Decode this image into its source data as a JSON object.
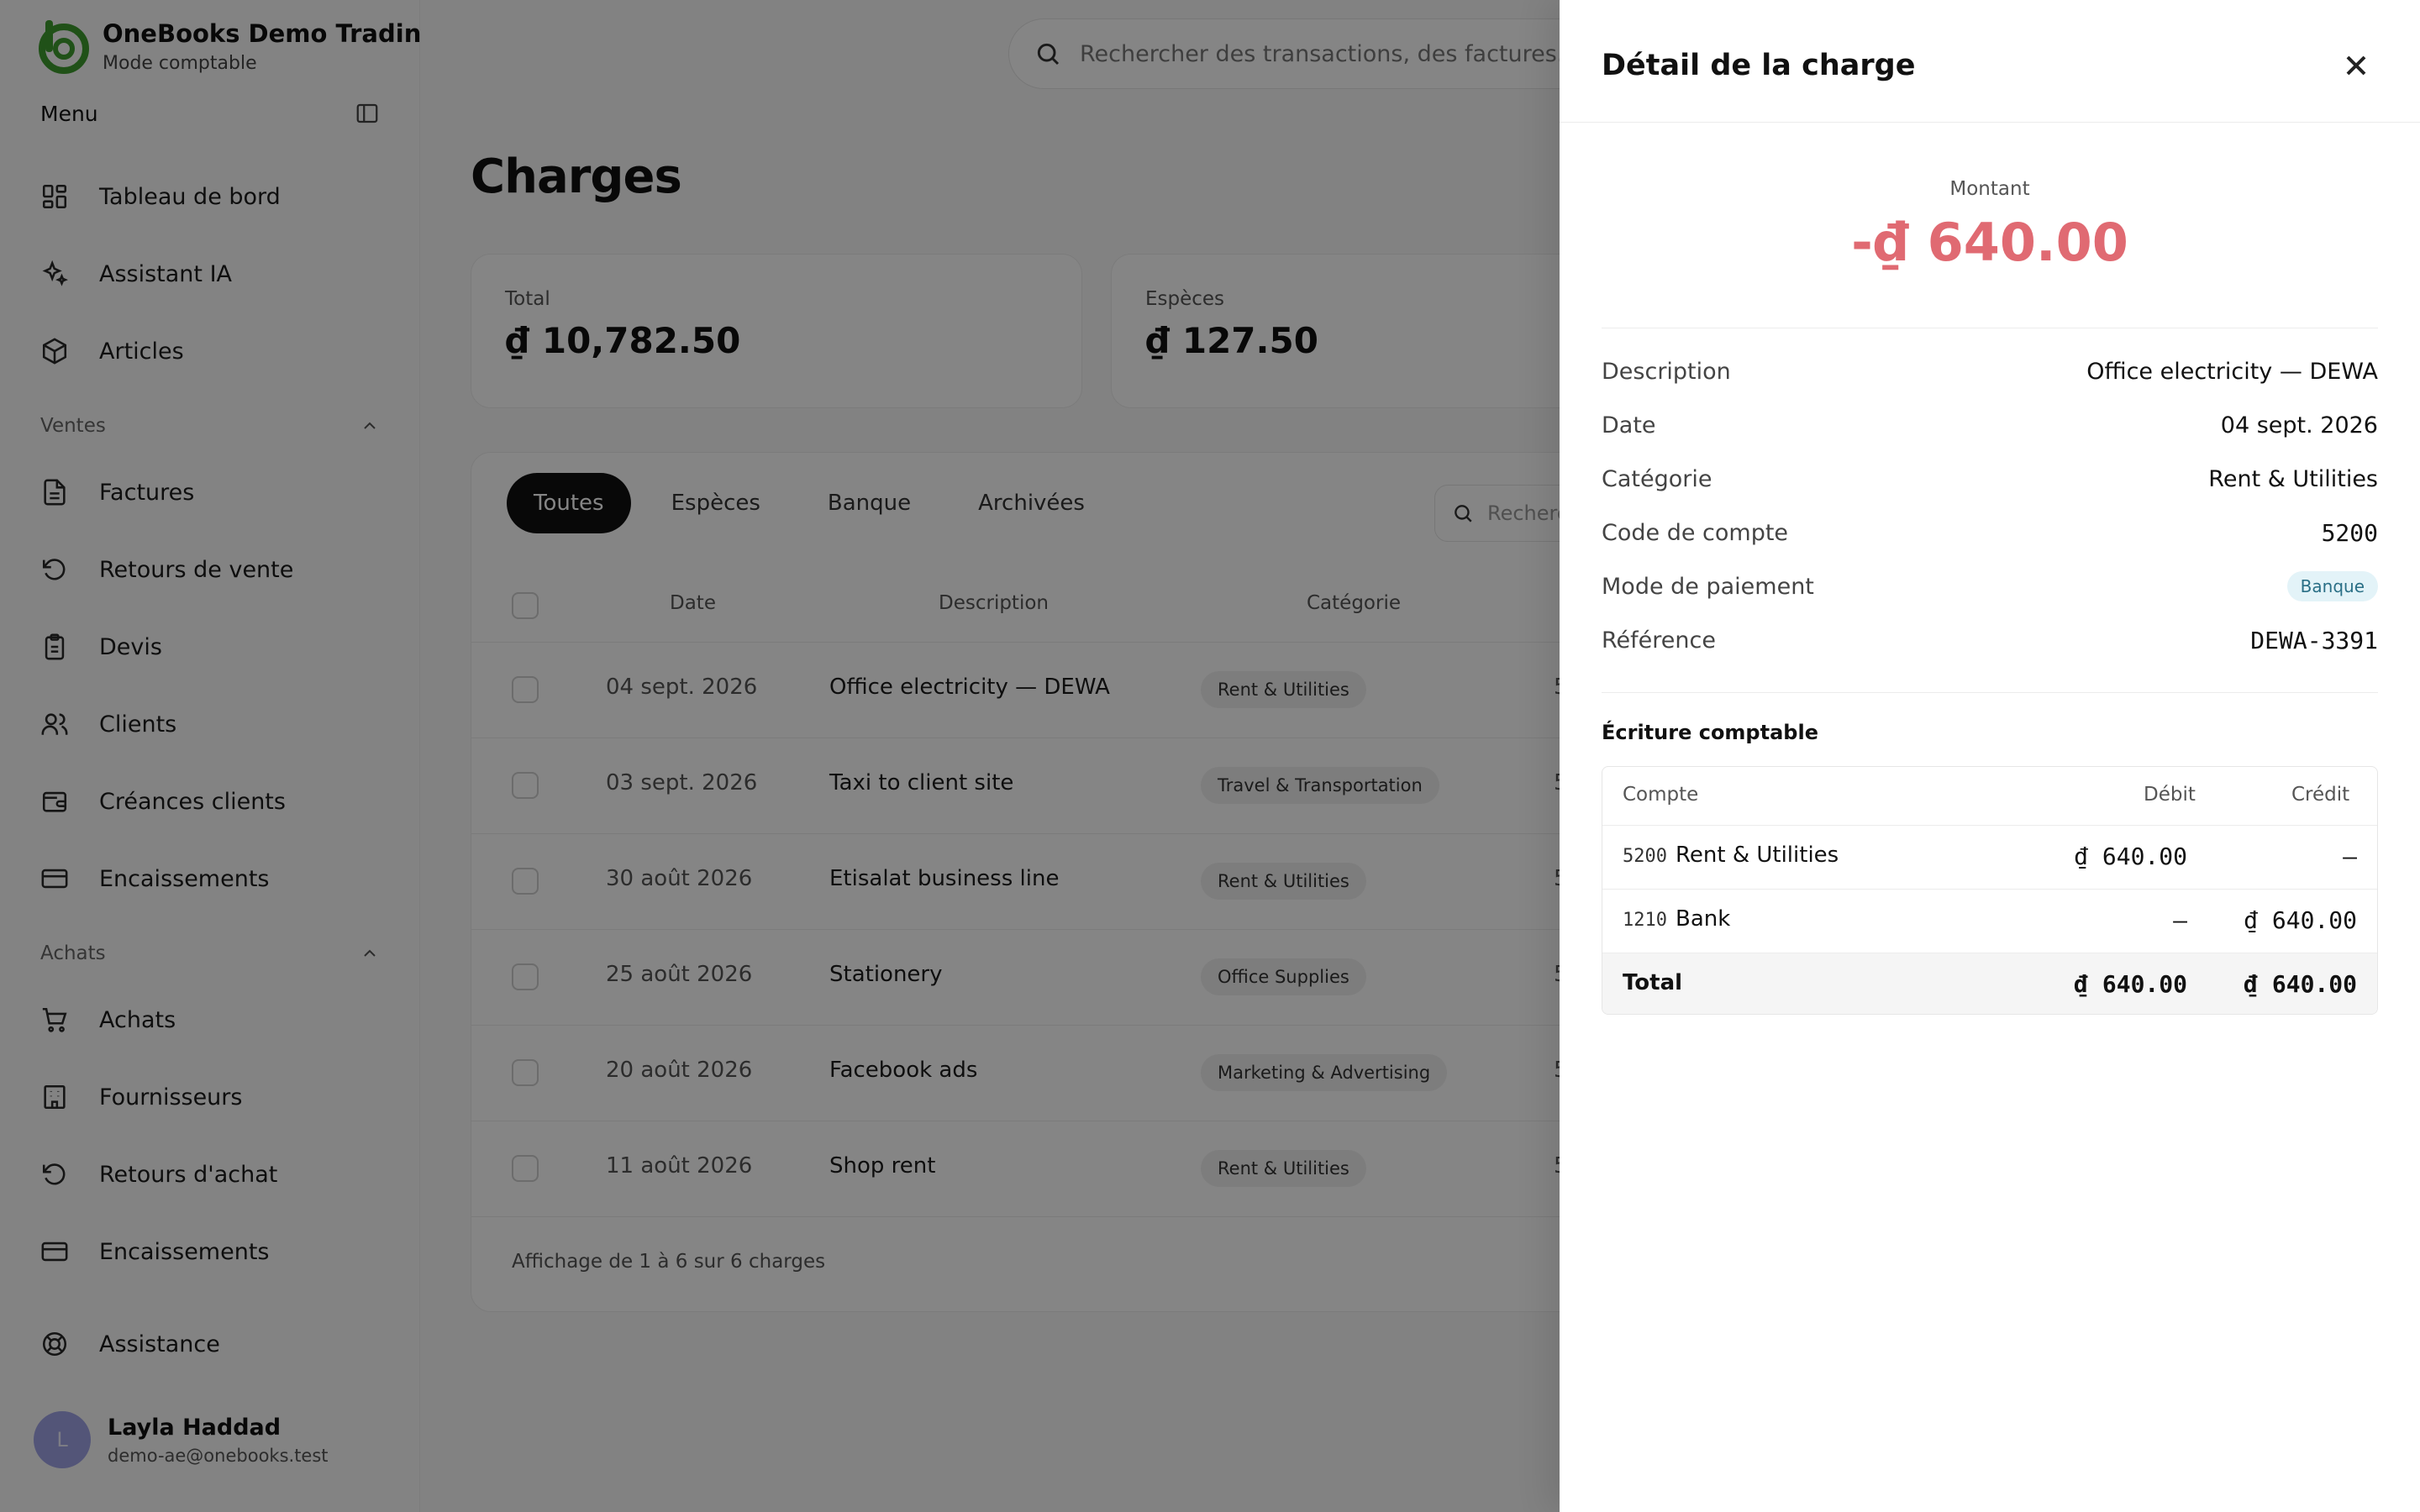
{
  "brand": {
    "name": "OneBooks Demo Tradin...",
    "mode": "Mode comptable"
  },
  "menu": {
    "title": "Menu"
  },
  "nav": {
    "dashboard": "Tableau de bord",
    "assistant": "Assistant IA",
    "articles": "Articles",
    "sales_section": "Ventes",
    "invoices": "Factures",
    "sales_returns": "Retours de vente",
    "quotes": "Devis",
    "clients": "Clients",
    "receivables": "Créances clients",
    "receipts_sales": "Encaissements",
    "purchases_section": "Achats",
    "purchases": "Achats",
    "suppliers": "Fournisseurs",
    "purchase_returns": "Retours d'achat",
    "receipts_purchases": "Encaissements",
    "support": "Assistance"
  },
  "user": {
    "initial": "L",
    "name": "Layla Haddad",
    "email": "demo-ae@onebooks.test"
  },
  "search": {
    "placeholder": "Rechercher des transactions, des factures..."
  },
  "page": {
    "title": "Charges"
  },
  "cards": [
    {
      "label": "Total",
      "value": "₫ 10,782.50"
    },
    {
      "label": "Espèces",
      "value": "₫ 127.50"
    }
  ],
  "tabs": [
    "Toutes",
    "Espèces",
    "Banque",
    "Archivées"
  ],
  "table_search": {
    "placeholder": "Recherc"
  },
  "table": {
    "headers": {
      "date": "Date",
      "description": "Description",
      "category": "Catégorie"
    },
    "rows": [
      {
        "date": "04 sept. 2026",
        "description": "Office electricity — DEWA",
        "category": "Rent & Utilities",
        "amount": "5"
      },
      {
        "date": "03 sept. 2026",
        "description": "Taxi to client site",
        "category": "Travel & Transportation",
        "amount": "5"
      },
      {
        "date": "30 août 2026",
        "description": "Etisalat business line",
        "category": "Rent & Utilities",
        "amount": "5"
      },
      {
        "date": "25 août 2026",
        "description": "Stationery",
        "category": "Office Supplies",
        "amount": "5"
      },
      {
        "date": "20 août 2026",
        "description": "Facebook ads",
        "category": "Marketing & Advertising",
        "amount": "5"
      },
      {
        "date": "11 août 2026",
        "description": "Shop rent",
        "category": "Rent & Utilities",
        "amount": "5"
      }
    ],
    "footer": "Affichage de 1 à 6 sur 6 charges"
  },
  "drawer": {
    "title": "Détail de la charge",
    "amount_label": "Montant",
    "amount_value": "-₫ 640.00",
    "fields": [
      {
        "label": "Description",
        "value": "Office electricity — DEWA"
      },
      {
        "label": "Date",
        "value": "04 sept. 2026"
      },
      {
        "label": "Catégorie",
        "value": "Rent & Utilities"
      },
      {
        "label": "Code de compte",
        "value": "5200"
      },
      {
        "label": "Mode de paiement",
        "value": "Banque"
      },
      {
        "label": "Référence",
        "value": "DEWA-3391"
      }
    ],
    "journal_title": "Écriture comptable",
    "journal": {
      "headers": {
        "account": "Compte",
        "debit": "Débit",
        "credit": "Crédit"
      },
      "rows": [
        {
          "code": "5200",
          "name": "Rent & Utilities",
          "debit": "₫ 640.00",
          "credit": "–"
        },
        {
          "code": "1210",
          "name": "Bank",
          "debit": "–",
          "credit": "₫ 640.00"
        }
      ],
      "total": {
        "label": "Total",
        "debit": "₫ 640.00",
        "credit": "₫ 640.00"
      }
    }
  },
  "colors": {
    "accent_green": "#3f9b2e",
    "negative_amount": "#e06a72",
    "badge_bank": "#e3f3f8"
  }
}
